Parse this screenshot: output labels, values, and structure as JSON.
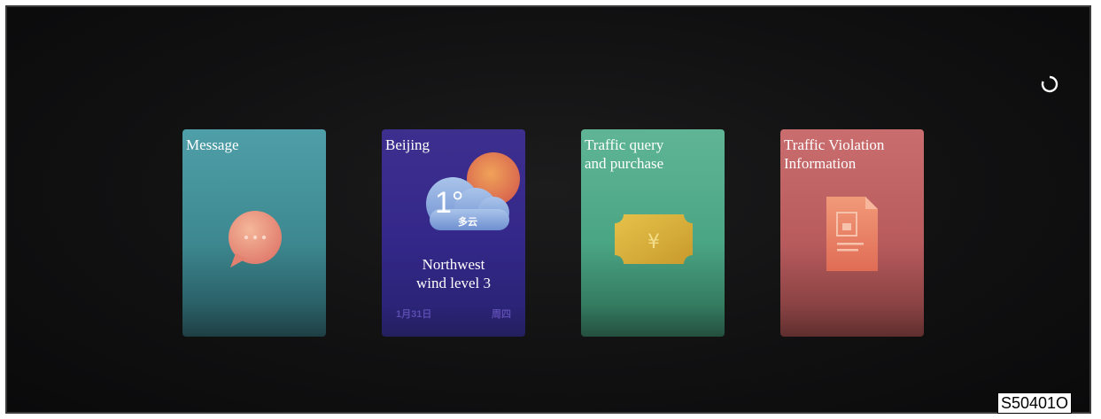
{
  "cards": [
    {
      "title": "Message",
      "icon": "chat-bubble-icon"
    },
    {
      "title": "Beijing",
      "temperature": "1°",
      "condition": "多云",
      "wind_line1": "Northwest",
      "wind_line2": "wind level 3",
      "date": "1月31日",
      "weekday": "周四",
      "icon": "weather-cloud-sun-icon"
    },
    {
      "title_line1": "Traffic query",
      "title_line2": "and purchase",
      "icon": "yuan-ticket-icon"
    },
    {
      "title_line1": "Traffic Violation",
      "title_line2": "Information",
      "icon": "document-icon"
    }
  ],
  "figure_code": "S50401O",
  "colors": {
    "message": "#4f9fa8",
    "weather": "#3d2f8e",
    "traffic_query": "#5fb596",
    "violation": "#c96d6f"
  }
}
